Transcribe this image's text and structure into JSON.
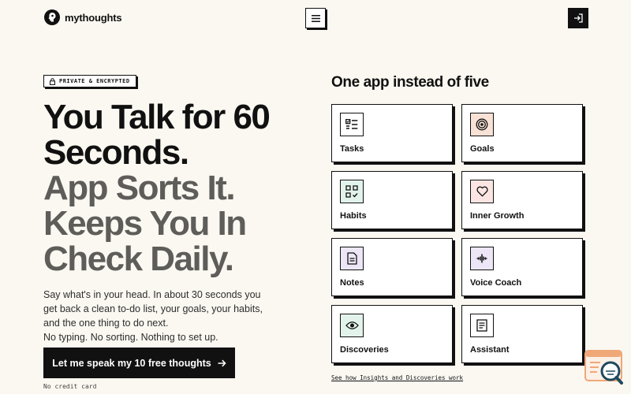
{
  "header": {
    "brand_name": "mythoughts",
    "menu_icon": "hamburger-menu-icon",
    "login_icon": "sign-in-icon"
  },
  "hero": {
    "badge_label": "PRIVATE & ENCRYPTED",
    "headline_dark": [
      "You Talk for 60",
      "Seconds."
    ],
    "headline_grey": [
      "App Sorts It.",
      "Keeps You In",
      "Check Daily."
    ],
    "description": [
      "Say what's in your head. In about 30 seconds you",
      "get back a clean to-do list, your goals, your habits,",
      "and the one thing to do next.",
      "No typing. No sorting. Nothing to set up."
    ],
    "cta_label": "Let me speak my 10 free thoughts",
    "no_card": "No credit card"
  },
  "features": {
    "title": "One app instead of five",
    "cards": [
      {
        "label": "Tasks",
        "icon": "checklist-icon",
        "color": "#ffffff"
      },
      {
        "label": "Goals",
        "icon": "target-icon",
        "color": "#f8e1d5"
      },
      {
        "label": "Habits",
        "icon": "grid-check-icon",
        "color": "#e2f3ec"
      },
      {
        "label": "Inner Growth",
        "icon": "heart-icon",
        "color": "#fae5e3"
      },
      {
        "label": "Notes",
        "icon": "document-icon",
        "color": "#ece6f6"
      },
      {
        "label": "Voice Coach",
        "icon": "voice-wave-icon",
        "color": "#ece6f6"
      },
      {
        "label": "Discoveries",
        "icon": "eye-icon",
        "color": "#e2f3ec"
      },
      {
        "label": "Assistant",
        "icon": "note-lines-icon",
        "color": "#ffffff"
      }
    ],
    "link_label": "See how Insights and Discoveries work"
  },
  "colors": {
    "background": "#fbf8f1",
    "ink": "#111111",
    "grey_headline": "#5e5d5a",
    "widget_accent": "#f0a878",
    "widget_dark": "#1e4a60"
  }
}
